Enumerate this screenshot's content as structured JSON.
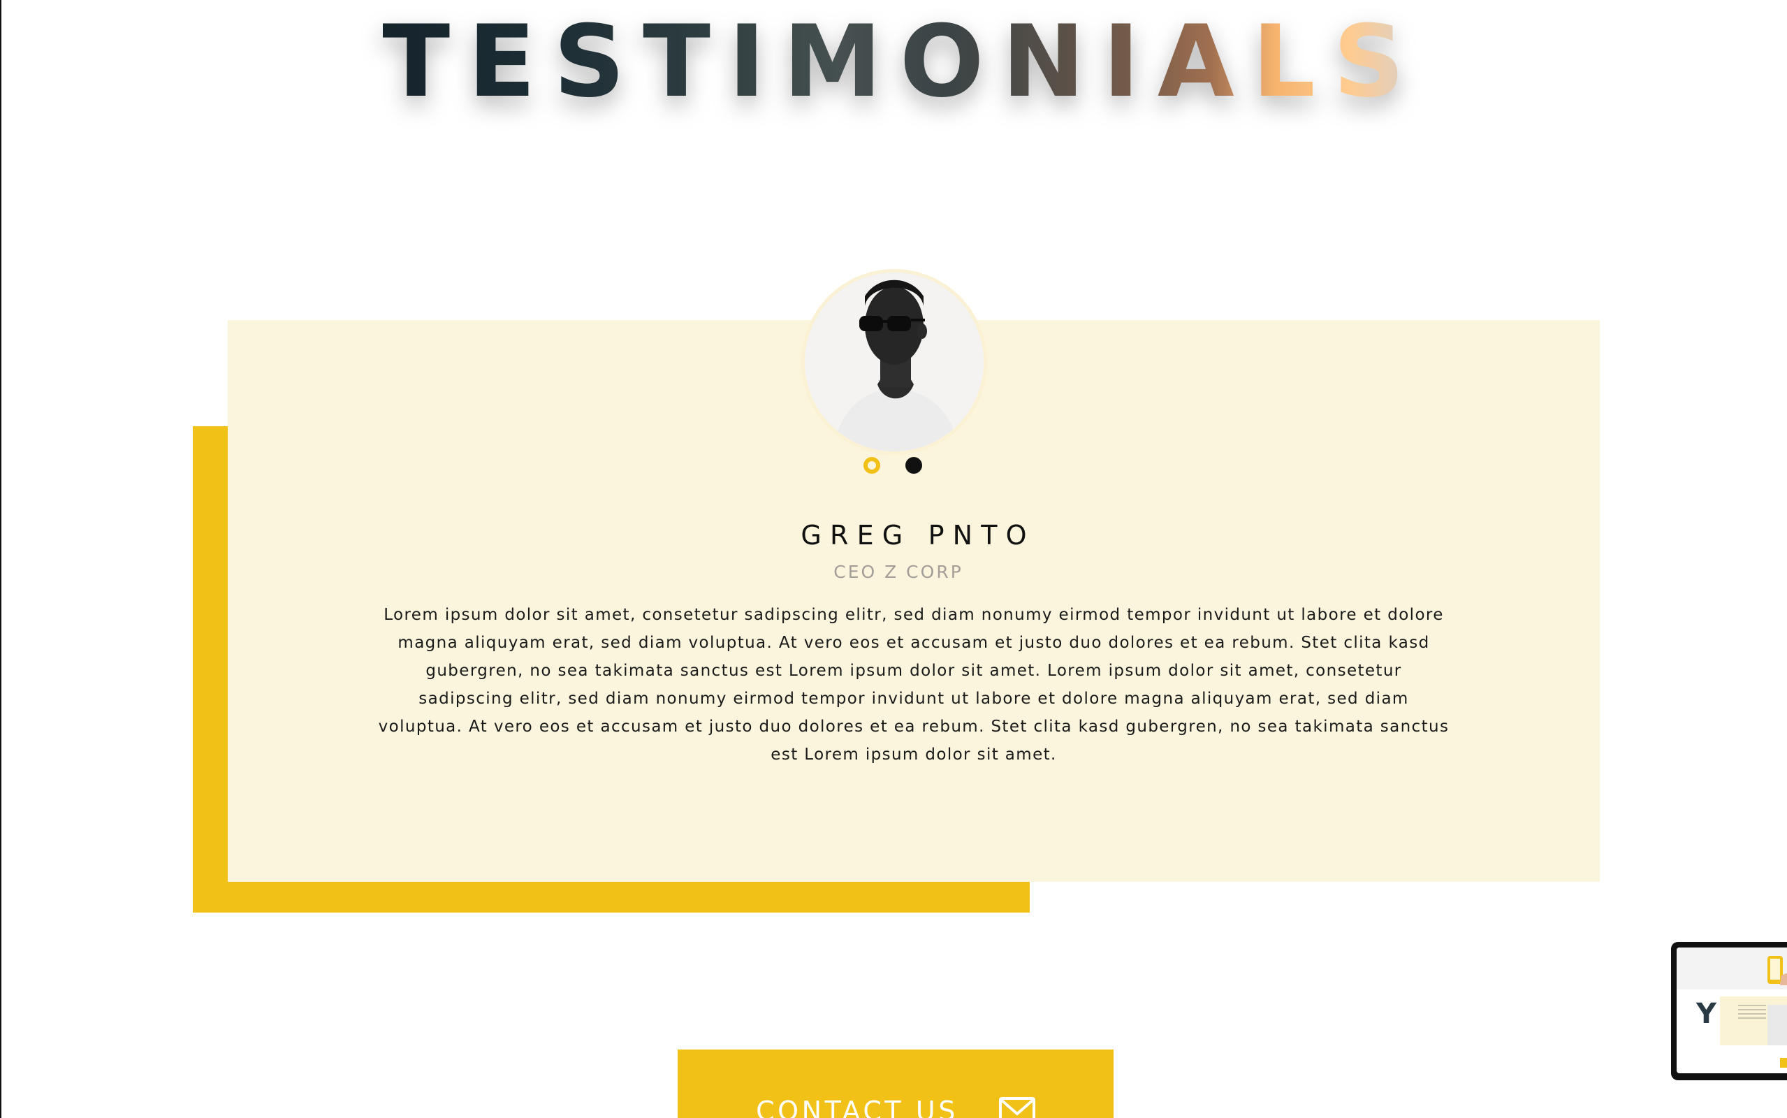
{
  "section": {
    "heading": "TESTIMONIALS"
  },
  "testimonial": {
    "avatar_icon": "person-portrait-icon",
    "name": "GREG PNTO",
    "role": "CEO Z CORP",
    "quote": "Lorem ipsum dolor sit amet, consetetur sadipscing elitr, sed diam nonumy eirmod tempor invidunt ut labore et dolore magna aliquyam erat, sed diam voluptua. At vero eos et accusam et justo duo dolores et ea rebum. Stet clita kasd gubergren, no sea takimata sanctus est Lorem ipsum dolor sit amet. Lorem ipsum dolor sit amet, consetetur sadipscing elitr, sed diam nonumy eirmod tempor invidunt ut labore et dolore magna aliquyam erat, sed diam voluptua. At vero eos et accusam et justo duo dolores et ea rebum. Stet clita kasd gubergren, no sea takimata sanctus est Lorem ipsum dolor sit amet."
  },
  "carousel": {
    "total_slides": 2,
    "active_slide": 1
  },
  "contact": {
    "label": "CONTACT US",
    "icon": "mail-icon"
  },
  "preview": {
    "icon": "page-preview-thumbnail"
  },
  "colors": {
    "accent": "#f1c117",
    "card_background": "#fcf5de",
    "text": "#111111",
    "muted": "#a39f98"
  }
}
